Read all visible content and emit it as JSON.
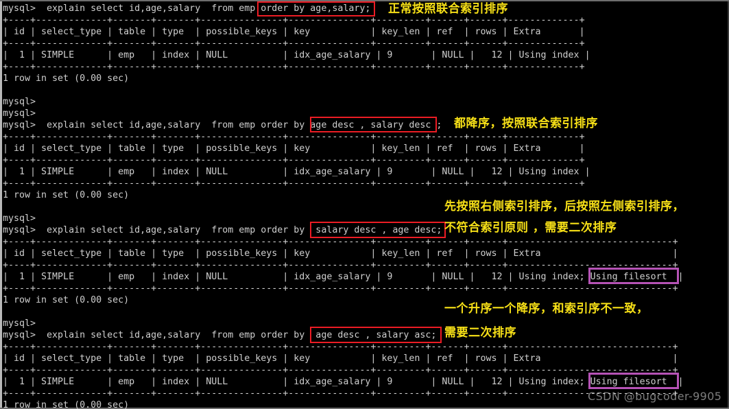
{
  "terminal": {
    "prompt": "mysql>",
    "font_color": "#cfcfcf",
    "background": "#000000",
    "lines": [
      "mysql>  explain select id,age,salary  from emp order by age,salary;",
      "+----+-------------+-------+-------+---------------+---------------+---------+------+------+-------------+",
      "| id | select_type | table | type  | possible_keys | key           | key_len | ref  | rows | Extra       |",
      "+----+-------------+-------+-------+---------------+---------------+---------+------+------+-------------+",
      "|  1 | SIMPLE      | emp   | index | NULL          | idx_age_salary | 9       | NULL |   12 | Using index |",
      "+----+-------------+-------+-------+---------------+---------------+---------+------+------+-------------+",
      "1 row in set (0.00 sec)",
      "",
      "mysql>",
      "mysql>",
      "mysql>  explain select id,age,salary  from emp order by age desc , salary desc ;",
      "+----+-------------+-------+-------+---------------+---------------+---------+------+------+-------------+",
      "| id | select_type | table | type  | possible_keys | key           | key_len | ref  | rows | Extra       |",
      "+----+-------------+-------+-------+---------------+---------------+---------+------+------+-------------+",
      "|  1 | SIMPLE      | emp   | index | NULL          | idx_age_salary | 9       | NULL |   12 | Using index |",
      "+----+-------------+-------+-------+---------------+---------------+---------+------+------+-------------+",
      "1 row in set (0.00 sec)",
      "",
      "mysql>",
      "mysql>  explain select id,age,salary  from emp order by  salary desc , age desc;",
      "+----+-------------+-------+-------+---------------+---------------+---------+------+------+------------------------------+",
      "| id | select_type | table | type  | possible_keys | key           | key_len | ref  | rows | Extra                        |",
      "+----+-------------+-------+-------+---------------+---------------+---------+------+------+------------------------------+",
      "|  1 | SIMPLE      | emp   | index | NULL          | idx_age_salary | 9       | NULL |   12 | Using index; Using filesort  |",
      "+----+-------------+-------+-------+---------------+---------------+---------+------+------+------------------------------+",
      "1 row in set (0.00 sec)",
      "",
      "mysql>",
      "mysql>  explain select id,age,salary  from emp order by  age desc , salary asc;",
      "+----+-------------+-------+-------+---------------+---------------+---------+------+------+------------------------------+",
      "| id | select_type | table | type  | possible_keys | key           | key_len | ref  | rows | Extra                        |",
      "+----+-------------+-------+-------+---------------+---------------+---------+------+------+------------------------------+",
      "|  1 | SIMPLE      | emp   | index | NULL          | idx_age_salary | 9       | NULL |   12 | Using index; Using filesort  |",
      "+----+-------------+-------+-------+---------------+---------------+---------+------+------+------------------------------+",
      "1 row in set (0.00 sec)"
    ]
  },
  "explain_table": {
    "columns": [
      "id",
      "select_type",
      "table",
      "type",
      "possible_keys",
      "key",
      "key_len",
      "ref",
      "rows",
      "Extra"
    ],
    "rows": [
      {
        "id": "1",
        "select_type": "SIMPLE",
        "table": "emp",
        "type": "index",
        "possible_keys": "NULL",
        "key": "idx_age_salary",
        "key_len": "9",
        "ref": "NULL",
        "rows": "12",
        "Extra": "Using index"
      },
      {
        "id": "1",
        "select_type": "SIMPLE",
        "table": "emp",
        "type": "index",
        "possible_keys": "NULL",
        "key": "idx_age_salary",
        "key_len": "9",
        "ref": "NULL",
        "rows": "12",
        "Extra": "Using index"
      },
      {
        "id": "1",
        "select_type": "SIMPLE",
        "table": "emp",
        "type": "index",
        "possible_keys": "NULL",
        "key": "idx_age_salary",
        "key_len": "9",
        "ref": "NULL",
        "rows": "12",
        "Extra": "Using index; Using filesort"
      },
      {
        "id": "1",
        "select_type": "SIMPLE",
        "table": "emp",
        "type": "index",
        "possible_keys": "NULL",
        "key": "idx_age_salary",
        "key_len": "9",
        "ref": "NULL",
        "rows": "12",
        "Extra": "Using index; Using filesort"
      }
    ],
    "result_status": "1 row in set (0.00 sec)"
  },
  "queries": [
    {
      "text": "mysql>  explain select id,age,salary  from emp order by age,salary;",
      "highlight": "order by age,salary"
    },
    {
      "text": "mysql>  explain select id,age,salary  from emp order by age desc , salary desc ;",
      "highlight": "age desc , salary desc"
    },
    {
      "text": "mysql>  explain select id,age,salary  from emp order by  salary desc , age desc;",
      "highlight": "salary desc , age desc"
    },
    {
      "text": "mysql>  explain select id,age,salary  from emp order by  age desc , salary asc;",
      "highlight": "age desc , salary asc"
    }
  ],
  "annotations": [
    {
      "id": "anno-1",
      "lines": [
        "正常按照联合索引排序"
      ]
    },
    {
      "id": "anno-2",
      "lines": [
        "都降序，按照联合索引排序"
      ]
    },
    {
      "id": "anno-3",
      "lines": [
        "先按照右侧索引排序，后按照左侧索引排序，",
        "不符合索引原则 ，需要二次排序"
      ]
    },
    {
      "id": "anno-4",
      "lines": [
        "一个升序一个降序，和索引序不一致，",
        "需要二次排序"
      ]
    }
  ],
  "highlights": {
    "red_color": "#ec1c24",
    "purple_color": "#b653b6",
    "filesort_label": "Using filesort"
  },
  "watermark": {
    "text": "CSDN @bugcoder-9905"
  }
}
